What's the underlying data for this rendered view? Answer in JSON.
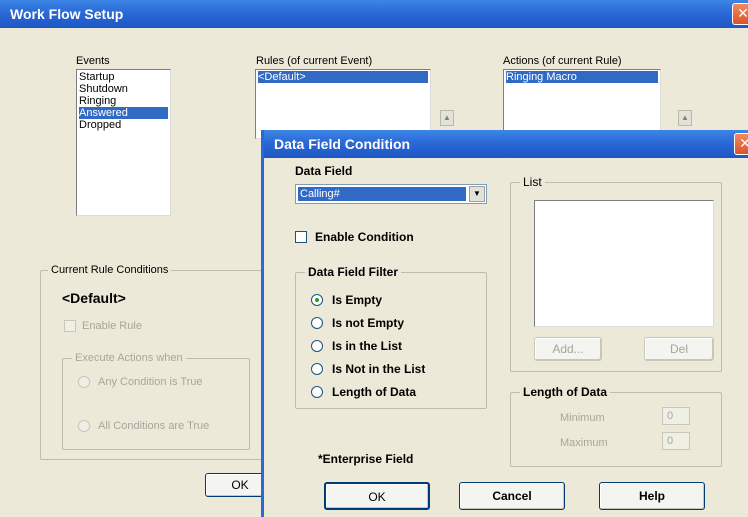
{
  "main_window": {
    "title": "Work Flow Setup",
    "close_glyph": "✕",
    "events": {
      "label": "Events",
      "items": [
        "Startup",
        "Shutdown",
        "Ringing",
        "Answered",
        "Dropped"
      ],
      "selected_index": 3
    },
    "rules": {
      "label": "Rules (of current Event)",
      "items": [
        "<Default>"
      ]
    },
    "actions": {
      "label": "Actions (of current Rule)",
      "items": [
        "Ringing Macro"
      ]
    },
    "current_rule_conditions": {
      "label": "Current Rule Conditions",
      "rule_name": "<Default>",
      "enable_rule_label": "Enable Rule",
      "execute_actions_when": {
        "label": "Execute Actions when",
        "options": [
          "Any Condition is True",
          "All Conditions are True"
        ]
      }
    },
    "ok_label": "OK"
  },
  "dialog": {
    "title": "Data Field Condition",
    "close_glyph": "✕",
    "data_field": {
      "label": "Data Field",
      "value": "Calling#"
    },
    "enable_condition_label": "Enable Condition",
    "filter": {
      "label": "Data Field Filter",
      "options": [
        "Is Empty",
        "Is not Empty",
        "Is in the List",
        "Is Not in the List",
        "Length of Data"
      ],
      "selected_index": 0
    },
    "list": {
      "label": "List",
      "add_label": "Add...",
      "del_label": "Del"
    },
    "length_of_data": {
      "label": "Length of Data",
      "minimum_label": "Minimum",
      "minimum_value": "0",
      "maximum_label": "Maximum",
      "maximum_value": "0"
    },
    "enterprise_note": "*Enterprise Field",
    "buttons": {
      "ok": "OK",
      "cancel": "Cancel",
      "help": "Help"
    }
  },
  "colors": {
    "titlebar": "#2a69d6",
    "selection": "#316ac5",
    "window_bg": "#ece9d8"
  }
}
